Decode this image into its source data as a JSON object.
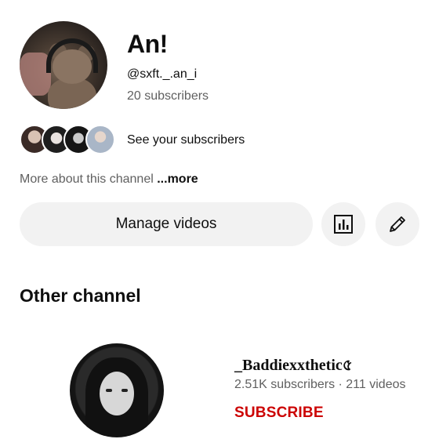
{
  "channel": {
    "name": "An!",
    "handle": "@sxft._.an_i",
    "subscribers": "20 subscribers"
  },
  "subscribers_row": {
    "label": "See your subscribers"
  },
  "about": {
    "text": "More about this channel",
    "more_label": "...more"
  },
  "actions": {
    "manage_label": "Manage videos",
    "analytics_icon": "analytics-icon",
    "edit_icon": "pencil-icon"
  },
  "other_section": {
    "title": "Other channel",
    "channel": {
      "name": "_Baddiexxthetic৫",
      "meta": "2.51K subscribers · 211 videos",
      "subscribe_label": "SUBSCRIBE",
      "subscribe_color": "#cc0000"
    }
  }
}
